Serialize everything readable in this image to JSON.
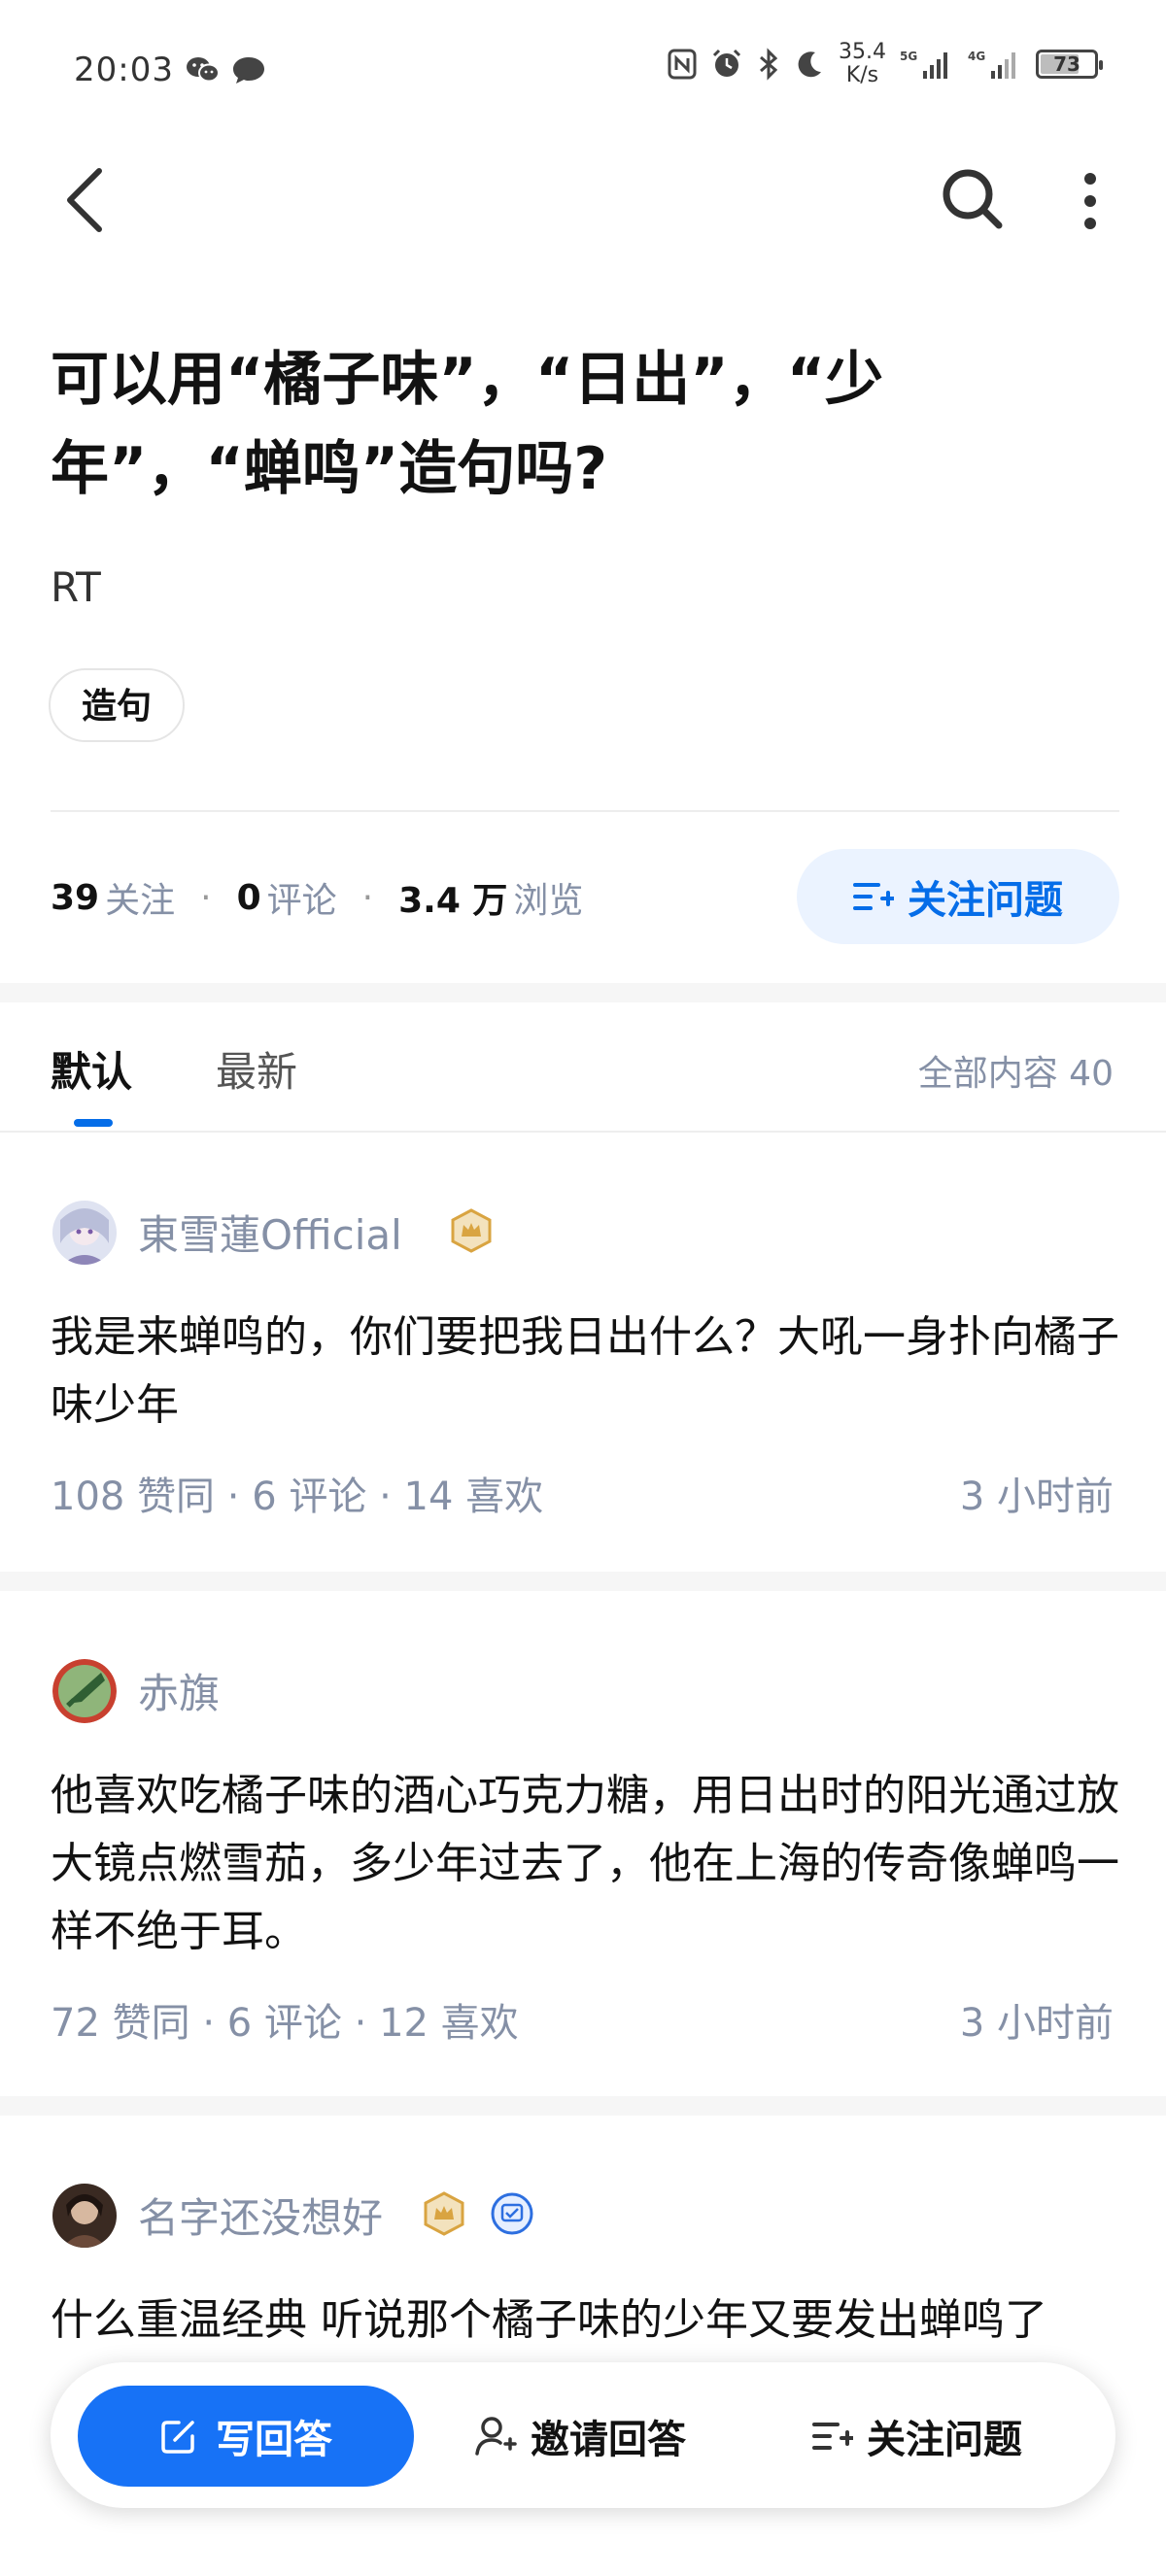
{
  "status_bar": {
    "time": "20:03",
    "network_speed_value": "35.4",
    "network_speed_unit": "K/s",
    "signal_1_label": "5G",
    "signal_2_label": "4G",
    "battery": "73",
    "battery_level_percent": 73,
    "icons": [
      "wechat-icon",
      "message-icon",
      "nfc-icon",
      "alarm-icon",
      "bluetooth-icon",
      "moon-icon",
      "signal-icon",
      "battery-icon"
    ]
  },
  "nav": {
    "icons": [
      "back-arrow-icon",
      "search-icon",
      "more-vertical-icon"
    ]
  },
  "question": {
    "title": "可以用“橘子味”，“日出”，“少年”，“蝉鸣”造句吗?",
    "description": "RT",
    "tag": "造句",
    "followers_count": "39",
    "followers_label": "关注",
    "comments_count": "0",
    "comments_label": "评论",
    "views_count": "3.4 万",
    "views_label": "浏览",
    "separator": "·",
    "follow_button": "关注问题"
  },
  "tabs": {
    "items": [
      "默认",
      "最新"
    ],
    "active": "默认",
    "all_content": "全部内容 40"
  },
  "answers": [
    {
      "author": "東雪蓮Official",
      "content": "我是来蝉鸣的，你们要把我日出什么？大吼一身扑向橘子味少年",
      "meta": "108  赞同 · 6  评论 · 14  喜欢",
      "time": "3 小时前"
    },
    {
      "author": "赤旗",
      "content": "他喜欢吃橘子味的酒心巧克力糖，用日出时的阳光通过放大镜点燃雪茄，多少年过去了，他在上海的传奇像蝉鸣一样不绝于耳。",
      "meta": "72  赞同 · 6  评论 · 12  喜欢",
      "time": "3 小时前"
    },
    {
      "author": "名字还没想好",
      "content": "什么重温经典 听说那个橘子味的少年又要发出蝉鸣了"
    }
  ],
  "bottom_bar": {
    "write_answer": "写回答",
    "invite_answer": "邀请回答",
    "follow_question": "关注问题"
  },
  "colors": {
    "accent": "#056de8",
    "primary_button": "#1772f6",
    "gold_badge": "#d9a441",
    "muted_text": "#8590a6"
  }
}
